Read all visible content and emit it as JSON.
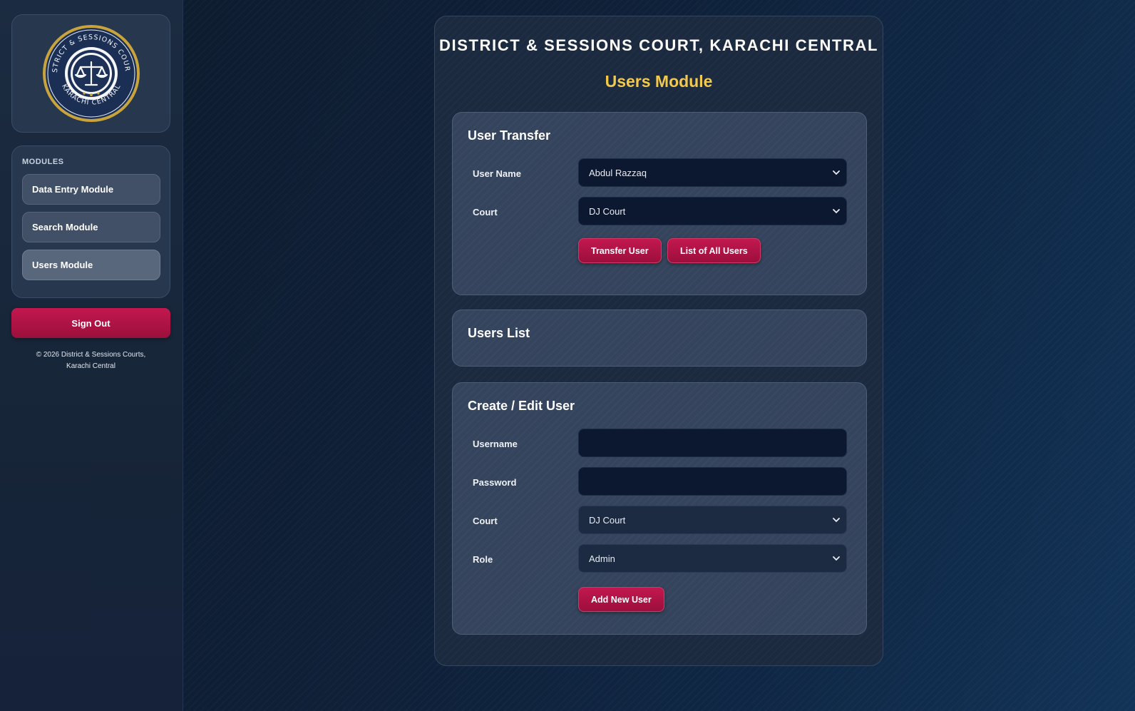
{
  "sidebar": {
    "logo": {
      "top_text": "DISTRICT & SESSIONS COURTS",
      "bottom_text": "KARACHI CENTRAL",
      "colors": {
        "ring": "#c9a33b",
        "inner": "#1b2f55"
      }
    },
    "modules_heading": "MODULES",
    "items": [
      {
        "label": "Data Entry Module",
        "active": false
      },
      {
        "label": "Search Module",
        "active": false
      },
      {
        "label": "Users Module",
        "active": true
      }
    ],
    "sign_out_label": "Sign Out",
    "copyright_line1": "© 2026 District & Sessions Courts,",
    "copyright_line2": "Karachi Central"
  },
  "header": {
    "court_title": "DISTRICT & SESSIONS COURT, KARACHI CENTRAL",
    "module_title": "Users Module"
  },
  "user_transfer": {
    "title": "User Transfer",
    "user_name_label": "User Name",
    "user_name_value": "Abdul Razzaq",
    "court_label": "Court",
    "court_value": "DJ Court",
    "transfer_button": "Transfer User",
    "list_button": "List of All Users"
  },
  "users_list": {
    "title": "Users List"
  },
  "create_edit": {
    "title": "Create / Edit User",
    "username_label": "Username",
    "username_value": "",
    "password_label": "Password",
    "password_value": "",
    "court_label": "Court",
    "court_value": "DJ Court",
    "role_label": "Role",
    "role_value": "Admin",
    "add_button": "Add New User"
  },
  "colors": {
    "accent": "#b5164a",
    "heading_gold": "#f2c94c"
  }
}
